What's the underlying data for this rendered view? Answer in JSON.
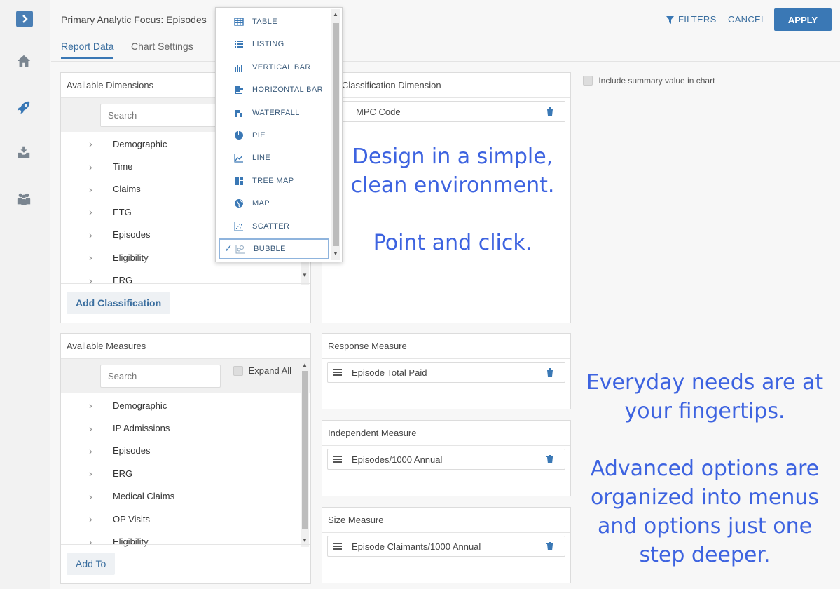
{
  "header": {
    "focus_title": "Primary Analytic Focus: Episodes",
    "filters_label": "FILTERS",
    "cancel_label": "CANCEL",
    "apply_label": "APPLY"
  },
  "tabs": [
    {
      "label": "Report Data",
      "active": true
    },
    {
      "label": "Chart Settings",
      "active": false
    }
  ],
  "rail": {
    "icons": [
      "chevron-right-icon",
      "home-icon",
      "rocket-icon",
      "inbox-download-icon",
      "users-icon"
    ]
  },
  "dimensions_panel": {
    "title": "Available Dimensions",
    "search_placeholder": "Search",
    "items": [
      "Demographic",
      "Time",
      "Claims",
      "ETG",
      "Episodes",
      "Eligibility",
      "ERG"
    ],
    "add_button": "Add Classification"
  },
  "classification_panel": {
    "title": "Classification Dimension",
    "field": "MPC Code"
  },
  "include_summary": {
    "label": "Include summary value in chart",
    "checked": false
  },
  "measures_panel": {
    "title": "Available Measures",
    "search_placeholder": "Search",
    "expand_all_label": "Expand All",
    "items": [
      "Demographic",
      "IP Admissions",
      "Episodes",
      "ERG",
      "Medical Claims",
      "OP Visits",
      "Eligibility"
    ],
    "add_button": "Add To"
  },
  "response_panel": {
    "title": "Response Measure",
    "field": "Episode Total Paid"
  },
  "independent_panel": {
    "title": "Independent Measure",
    "field": "Episodes/1000 Annual"
  },
  "size_panel": {
    "title": "Size Measure",
    "field": "Episode Claimants/1000 Annual"
  },
  "chart_type_menu": {
    "items": [
      "TABLE",
      "LISTING",
      "VERTICAL BAR",
      "HORIZONTAL BAR",
      "WATERFALL",
      "PIE",
      "LINE",
      "TREE MAP",
      "MAP",
      "SCATTER",
      "BUBBLE"
    ],
    "selected": "BUBBLE"
  },
  "promo": {
    "line1": "Design in a simple,",
    "line2": "clean environment.",
    "line3": "Point and click.",
    "line4": "Everyday needs are at",
    "line5": "your fingertips.",
    "line6": "Advanced options are",
    "line7": "organized into menus",
    "line8": "and options just one",
    "line9": "step deeper."
  },
  "colors": {
    "accent": "#3a78b5",
    "promo_text": "#3d63e0"
  }
}
